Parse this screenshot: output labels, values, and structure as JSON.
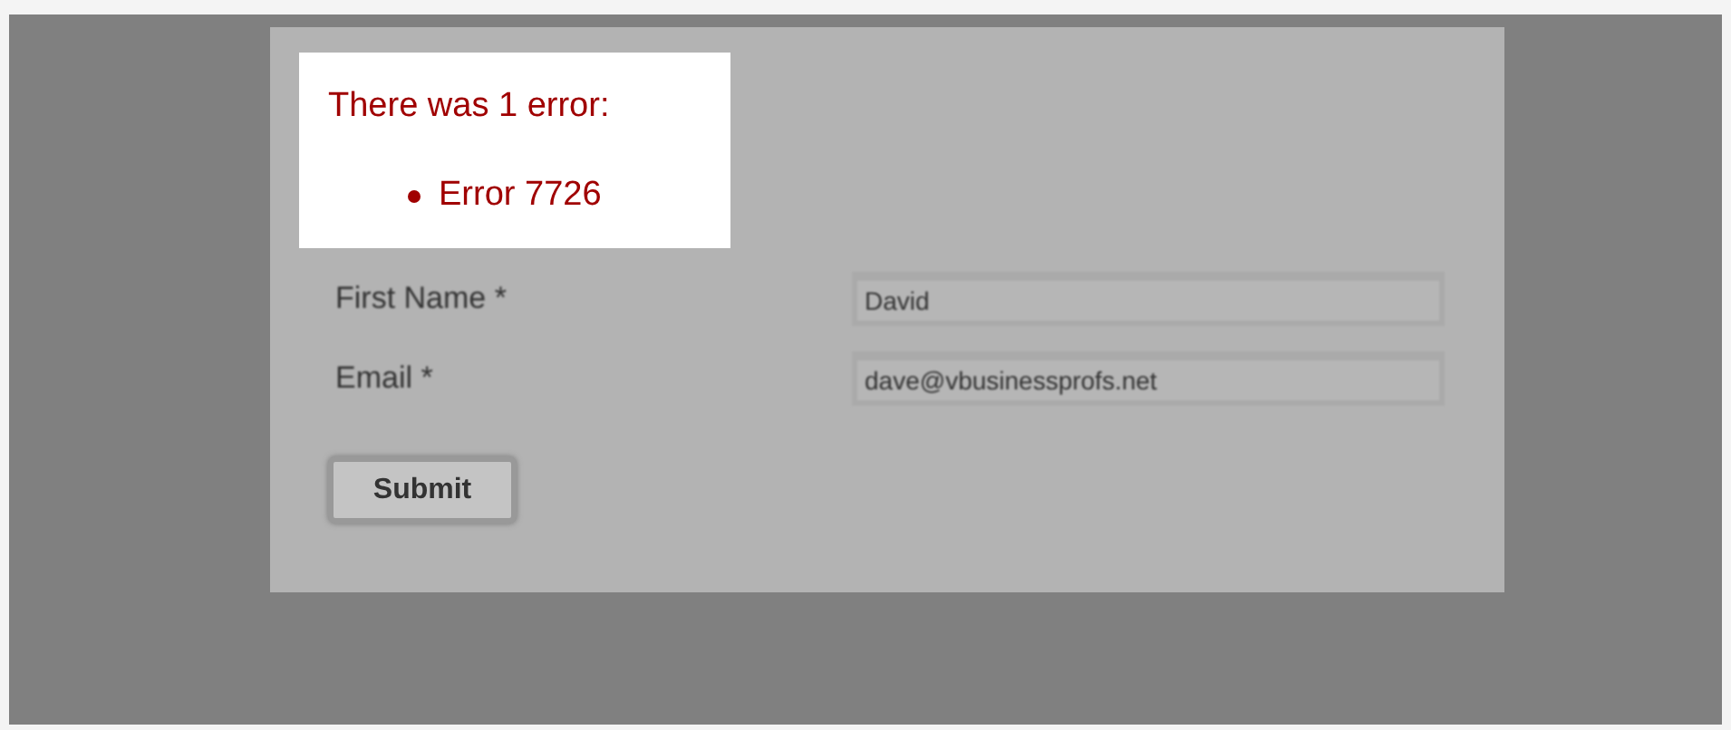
{
  "error_box": {
    "heading": "There was 1 error:",
    "errors": [
      "Error 7726"
    ]
  },
  "fields": [
    {
      "label": "First Name *",
      "value": "David"
    },
    {
      "label": "Email *",
      "value": "dave@vbusinessprofs.net"
    }
  ],
  "submit_button": "Submit"
}
